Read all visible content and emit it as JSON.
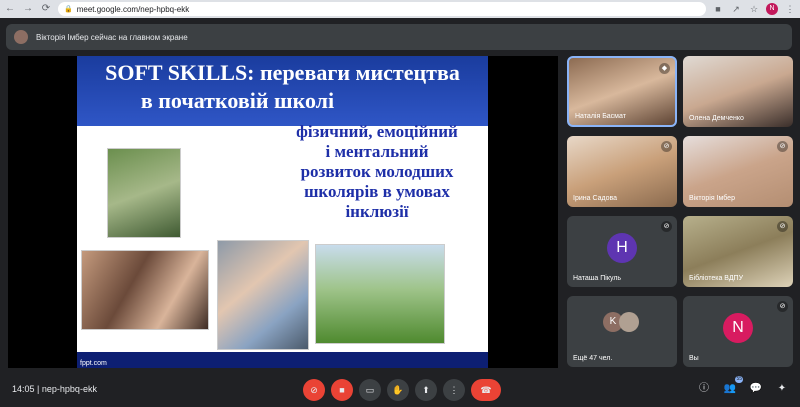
{
  "browser": {
    "url": "meet.google.com/nep-hpbq-ekk",
    "profile_initial": "N"
  },
  "presenting": {
    "text": "Вікторія Імбер сейчас на главном экране"
  },
  "slide": {
    "title_line1": "SOFT SKILLS: переваги мистецтва",
    "title_line2": "в початковій школі",
    "subtitle_lines": [
      "фізичний, емоційний",
      "і ментальний",
      "розвиток молодших",
      "школярів в умовах",
      "інклюзії"
    ],
    "footer": "fppt.com"
  },
  "participants": [
    {
      "name": "Наталія Басмат",
      "mic": "mic-on-icon"
    },
    {
      "name": "Олена Демченко",
      "mic": ""
    },
    {
      "name": "Ірина Садова",
      "mic": "mic-off-icon"
    },
    {
      "name": "Вікторія Імбер",
      "mic": "mic-off-icon"
    },
    {
      "name": "Наташа Пікуль",
      "initial": "Н",
      "mic": "mic-off-icon"
    },
    {
      "name": "Бібліотека ВДПУ",
      "mic": "mic-off-icon"
    },
    {
      "name": "Ещё 47 чел.",
      "initial": "K"
    },
    {
      "name": "Вы",
      "initial": "N",
      "mic": "mic-off-icon"
    }
  ],
  "bottom": {
    "time": "14:05",
    "separator": "|",
    "meeting_code": "nep-hpbq-ekk",
    "people_count": "55"
  }
}
